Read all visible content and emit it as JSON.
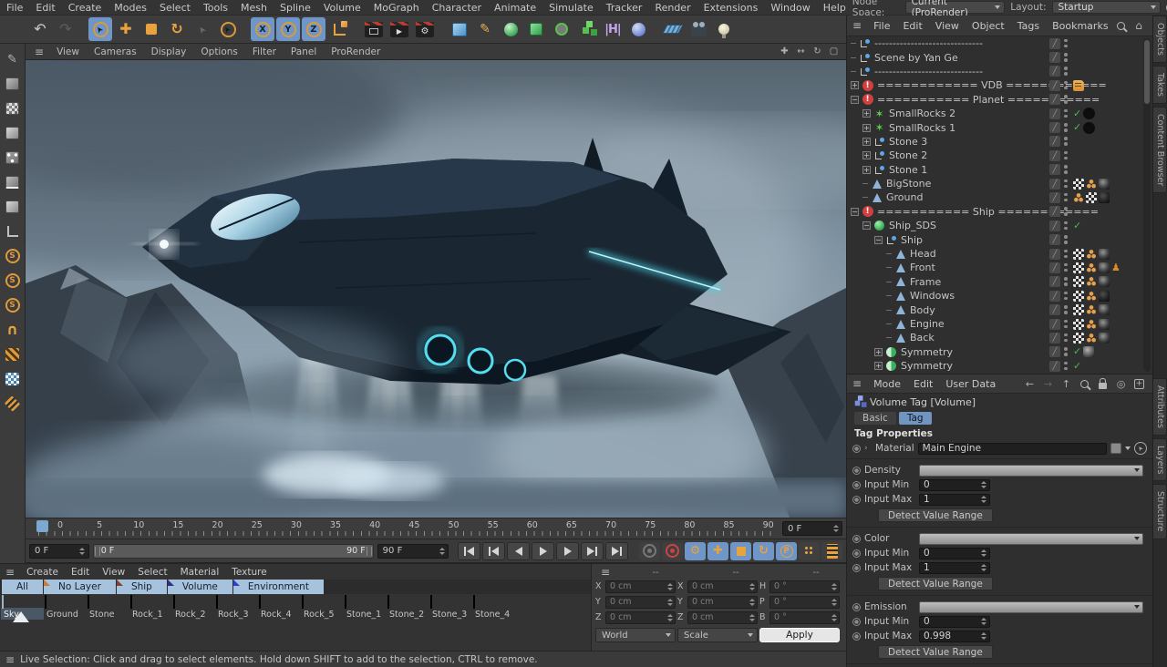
{
  "menubar": {
    "items": [
      "File",
      "Edit",
      "Create",
      "Modes",
      "Select",
      "Tools",
      "Mesh",
      "Spline",
      "Volume",
      "MoGraph",
      "Character",
      "Animate",
      "Simulate",
      "Tracker",
      "Render",
      "Extensions",
      "Window",
      "Help"
    ],
    "node_space_label": "Node Space:",
    "node_space_value": "Current (ProRender)",
    "layout_label": "Layout:",
    "layout_value": "Startup"
  },
  "toolbar": {
    "icons": [
      "undo",
      "redo",
      "live-selection",
      "move",
      "scale",
      "rotate",
      "last-tool",
      "selection",
      "x-axis-lock",
      "y-axis-lock",
      "z-axis-lock",
      "coordinate-system",
      "render-view",
      "render-to-picture-viewer",
      "render-settings",
      "add-cube",
      "pen-spline",
      "subdivision-surface",
      "extrude-generator",
      "mograph-cloner",
      "volume-builder",
      "bend-deformer",
      "field",
      "floor",
      "camera",
      "light"
    ],
    "active": [
      "live-selection",
      "x-axis-lock",
      "y-axis-lock",
      "z-axis-lock"
    ]
  },
  "left_toolbar": {
    "icons": [
      "make-editable",
      "model-mode",
      "texture-mode",
      "workplane-mode",
      "points-mode",
      "edges-mode",
      "polygons-mode",
      "enable-axis",
      "viewport-solo-off",
      "viewport-solo-single",
      "viewport-solo-hierarchy",
      "enable-snap",
      "workplane-snapping",
      "locked-workplane",
      "quantize"
    ]
  },
  "viewport": {
    "menu": [
      "View",
      "Cameras",
      "Display",
      "Options",
      "Filter",
      "Panel",
      "ProRender"
    ],
    "corner_icons": [
      "pan-view",
      "zoom-view",
      "rotate-view",
      "maximize-view"
    ]
  },
  "timeline": {
    "tick_labels": [
      "0",
      "5",
      "10",
      "15",
      "20",
      "25",
      "30",
      "35",
      "40",
      "45",
      "50",
      "55",
      "60",
      "65",
      "70",
      "75",
      "80",
      "85",
      "90"
    ],
    "current_frame_field": "0 F"
  },
  "transport": {
    "current_frame": "0 F",
    "range_start": "0 F",
    "range_end": "90 F",
    "end_frame": "90 F",
    "buttons": [
      "goto-start",
      "previous-key",
      "previous-frame",
      "play-forward",
      "next-frame",
      "next-key",
      "goto-end"
    ],
    "toggles": [
      {
        "name": "record-keyframe",
        "state": "off"
      },
      {
        "name": "autokeying",
        "state": "red"
      },
      {
        "name": "keyframe-selection",
        "state": "on"
      },
      {
        "name": "record-position",
        "state": "on"
      },
      {
        "name": "record-scale",
        "state": "on"
      },
      {
        "name": "record-rotation",
        "state": "on"
      },
      {
        "name": "record-parameter",
        "state": "on"
      },
      {
        "name": "record-pla",
        "state": "off"
      },
      {
        "name": "timeline-mode",
        "state": "off"
      }
    ]
  },
  "materials": {
    "menu": [
      "Create",
      "Edit",
      "View",
      "Select",
      "Material",
      "Texture"
    ],
    "tabs": [
      {
        "label": "All",
        "color": null
      },
      {
        "label": "No Layer",
        "color": "#c87a3a"
      },
      {
        "label": "Ship",
        "color": "#8a4030"
      },
      {
        "label": "Volume",
        "color": "#30308a"
      },
      {
        "label": "Environment",
        "color": "#3040c8"
      }
    ],
    "selected": "Sky",
    "items": [
      {
        "name": "Sky",
        "kind": "sky"
      },
      {
        "name": "Ground",
        "kind": "sphere"
      },
      {
        "name": "Stone",
        "kind": "black"
      },
      {
        "name": "Rock_1",
        "kind": "sphere"
      },
      {
        "name": "Rock_2",
        "kind": "sphere"
      },
      {
        "name": "Rock_3",
        "kind": "sphere"
      },
      {
        "name": "Rock_4",
        "kind": "sphere"
      },
      {
        "name": "Rock_5",
        "kind": "sphere"
      },
      {
        "name": "Stone_1",
        "kind": "sphere"
      },
      {
        "name": "Stone_2",
        "kind": "sphere"
      },
      {
        "name": "Stone_3",
        "kind": "sphere"
      },
      {
        "name": "Stone_4",
        "kind": "sphere"
      }
    ]
  },
  "coords": {
    "columns": [
      {
        "header": "--",
        "rows": [
          {
            "label": "X",
            "value": "0 cm"
          },
          {
            "label": "Y",
            "value": "0 cm"
          },
          {
            "label": "Z",
            "value": "0 cm"
          }
        ],
        "footer": "World",
        "footer_kind": "dropdown"
      },
      {
        "header": "--",
        "rows": [
          {
            "label": "X",
            "value": "0 cm"
          },
          {
            "label": "Y",
            "value": "0 cm"
          },
          {
            "label": "Z",
            "value": "0 cm"
          }
        ],
        "footer": "Scale",
        "footer_kind": "dropdown"
      },
      {
        "header": "--",
        "rows": [
          {
            "label": "H",
            "value": "0 °"
          },
          {
            "label": "P",
            "value": "0 °"
          },
          {
            "label": "B",
            "value": "0 °"
          }
        ],
        "footer": "Apply",
        "footer_kind": "button"
      }
    ]
  },
  "objects": {
    "menu": [
      "File",
      "Edit",
      "View",
      "Object",
      "Tags",
      "Bookmarks"
    ],
    "menu_icons": [
      "search",
      "home",
      "filter",
      "add"
    ],
    "items": [
      {
        "name": "------------------------------",
        "icon": "null",
        "depth": 0
      },
      {
        "name": "Scene by Yan Ge",
        "icon": "null",
        "depth": 0
      },
      {
        "name": "------------------------------",
        "icon": "null",
        "depth": 0
      },
      {
        "name": "============ VDB ============",
        "icon": "alert",
        "depth": 0,
        "expand": "plus",
        "tags": [
          "note"
        ]
      },
      {
        "name": "=========== Planet ===========",
        "icon": "alert",
        "depth": 0,
        "expand": "minus"
      },
      {
        "name": "SmallRocks 2",
        "icon": "matrix",
        "depth": 1,
        "expand": "plus",
        "check": true,
        "tags": [
          "layer"
        ]
      },
      {
        "name": "SmallRocks 1",
        "icon": "matrix",
        "depth": 1,
        "expand": "plus",
        "check": true,
        "tags": [
          "layer"
        ]
      },
      {
        "name": "Stone 3",
        "icon": "null",
        "depth": 1,
        "expand": "plus"
      },
      {
        "name": "Stone 2",
        "icon": "null",
        "depth": 1,
        "expand": "plus"
      },
      {
        "name": "Stone 1",
        "icon": "null",
        "depth": 1,
        "expand": "plus"
      },
      {
        "name": "BigStone",
        "icon": "poly",
        "depth": 1,
        "tags": [
          "checker",
          "seldots",
          "mat"
        ]
      },
      {
        "name": "Ground",
        "icon": "poly",
        "depth": 1,
        "tags": [
          "seldots",
          "checker",
          "matdark"
        ]
      },
      {
        "name": "=========== Ship ============",
        "icon": "alert",
        "depth": 0,
        "expand": "minus"
      },
      {
        "name": "Ship_SDS",
        "icon": "sds",
        "depth": 1,
        "expand": "minus",
        "check": true
      },
      {
        "name": "Ship",
        "icon": "null",
        "depth": 2,
        "expand": "minus"
      },
      {
        "name": "Head",
        "icon": "poly",
        "depth": 3,
        "tags": [
          "checker",
          "seldots",
          "mat"
        ]
      },
      {
        "name": "Front",
        "icon": "poly",
        "depth": 3,
        "tags": [
          "checker",
          "seldots",
          "mat",
          "xchar"
        ]
      },
      {
        "name": "Frame",
        "icon": "poly",
        "depth": 3,
        "tags": [
          "checker",
          "seldots",
          "mat"
        ]
      },
      {
        "name": "Windows",
        "icon": "poly",
        "depth": 3,
        "tags": [
          "checker",
          "seldots",
          "matdark"
        ]
      },
      {
        "name": "Body",
        "icon": "poly",
        "depth": 3,
        "tags": [
          "checker",
          "seldots",
          "mat"
        ]
      },
      {
        "name": "Engine",
        "icon": "poly",
        "depth": 3,
        "tags": [
          "checker",
          "seldots",
          "mat"
        ]
      },
      {
        "name": "Back",
        "icon": "poly",
        "depth": 3,
        "tags": [
          "checker",
          "seldots",
          "mat"
        ]
      },
      {
        "name": "Symmetry",
        "icon": "sym",
        "depth": 2,
        "expand": "plus",
        "check": true,
        "tags": [
          "matlight"
        ]
      },
      {
        "name": "Symmetry",
        "icon": "sym",
        "depth": 2,
        "expand": "plus",
        "check": true
      }
    ]
  },
  "attributes": {
    "menu": [
      "Mode",
      "Edit",
      "User Data"
    ],
    "menu_icons": [
      "back",
      "forward",
      "up",
      "search",
      "lock",
      "target",
      "add"
    ],
    "title": "Volume Tag [Volume]",
    "tabs": [
      "Basic",
      "Tag"
    ],
    "active_tab": "Tag",
    "properties_header": "Tag Properties",
    "material_label": "Material",
    "material_value": "Main Engine",
    "channels": [
      {
        "label": "Density",
        "min_label": "Input Min",
        "min_value": "0",
        "max_label": "Input Max",
        "max_value": "1",
        "button_label": "Detect Value Range"
      },
      {
        "label": "Color",
        "min_label": "Input Min",
        "min_value": "0",
        "max_label": "Input Max",
        "max_value": "1",
        "button_label": "Detect Value Range"
      },
      {
        "label": "Emission",
        "min_label": "Input Min",
        "min_value": "0",
        "max_label": "Input Max",
        "max_value": "0.998",
        "button_label": "Detect Value Range"
      }
    ]
  },
  "statusbar": {
    "text": "Live Selection: Click and drag to select elements. Hold down SHIFT to add to the selection, CTRL to remove."
  },
  "side_tabs": {
    "top": [
      "Objects",
      "Takes",
      "Content Browser"
    ],
    "bottom": [
      "Attributes",
      "Layers",
      "Structure"
    ]
  },
  "colors": {
    "accent_blue": "#6e96c8",
    "accent_orange": "#e8a23e",
    "engine_glow": "#56e0f0",
    "alert_red": "#d04040"
  }
}
